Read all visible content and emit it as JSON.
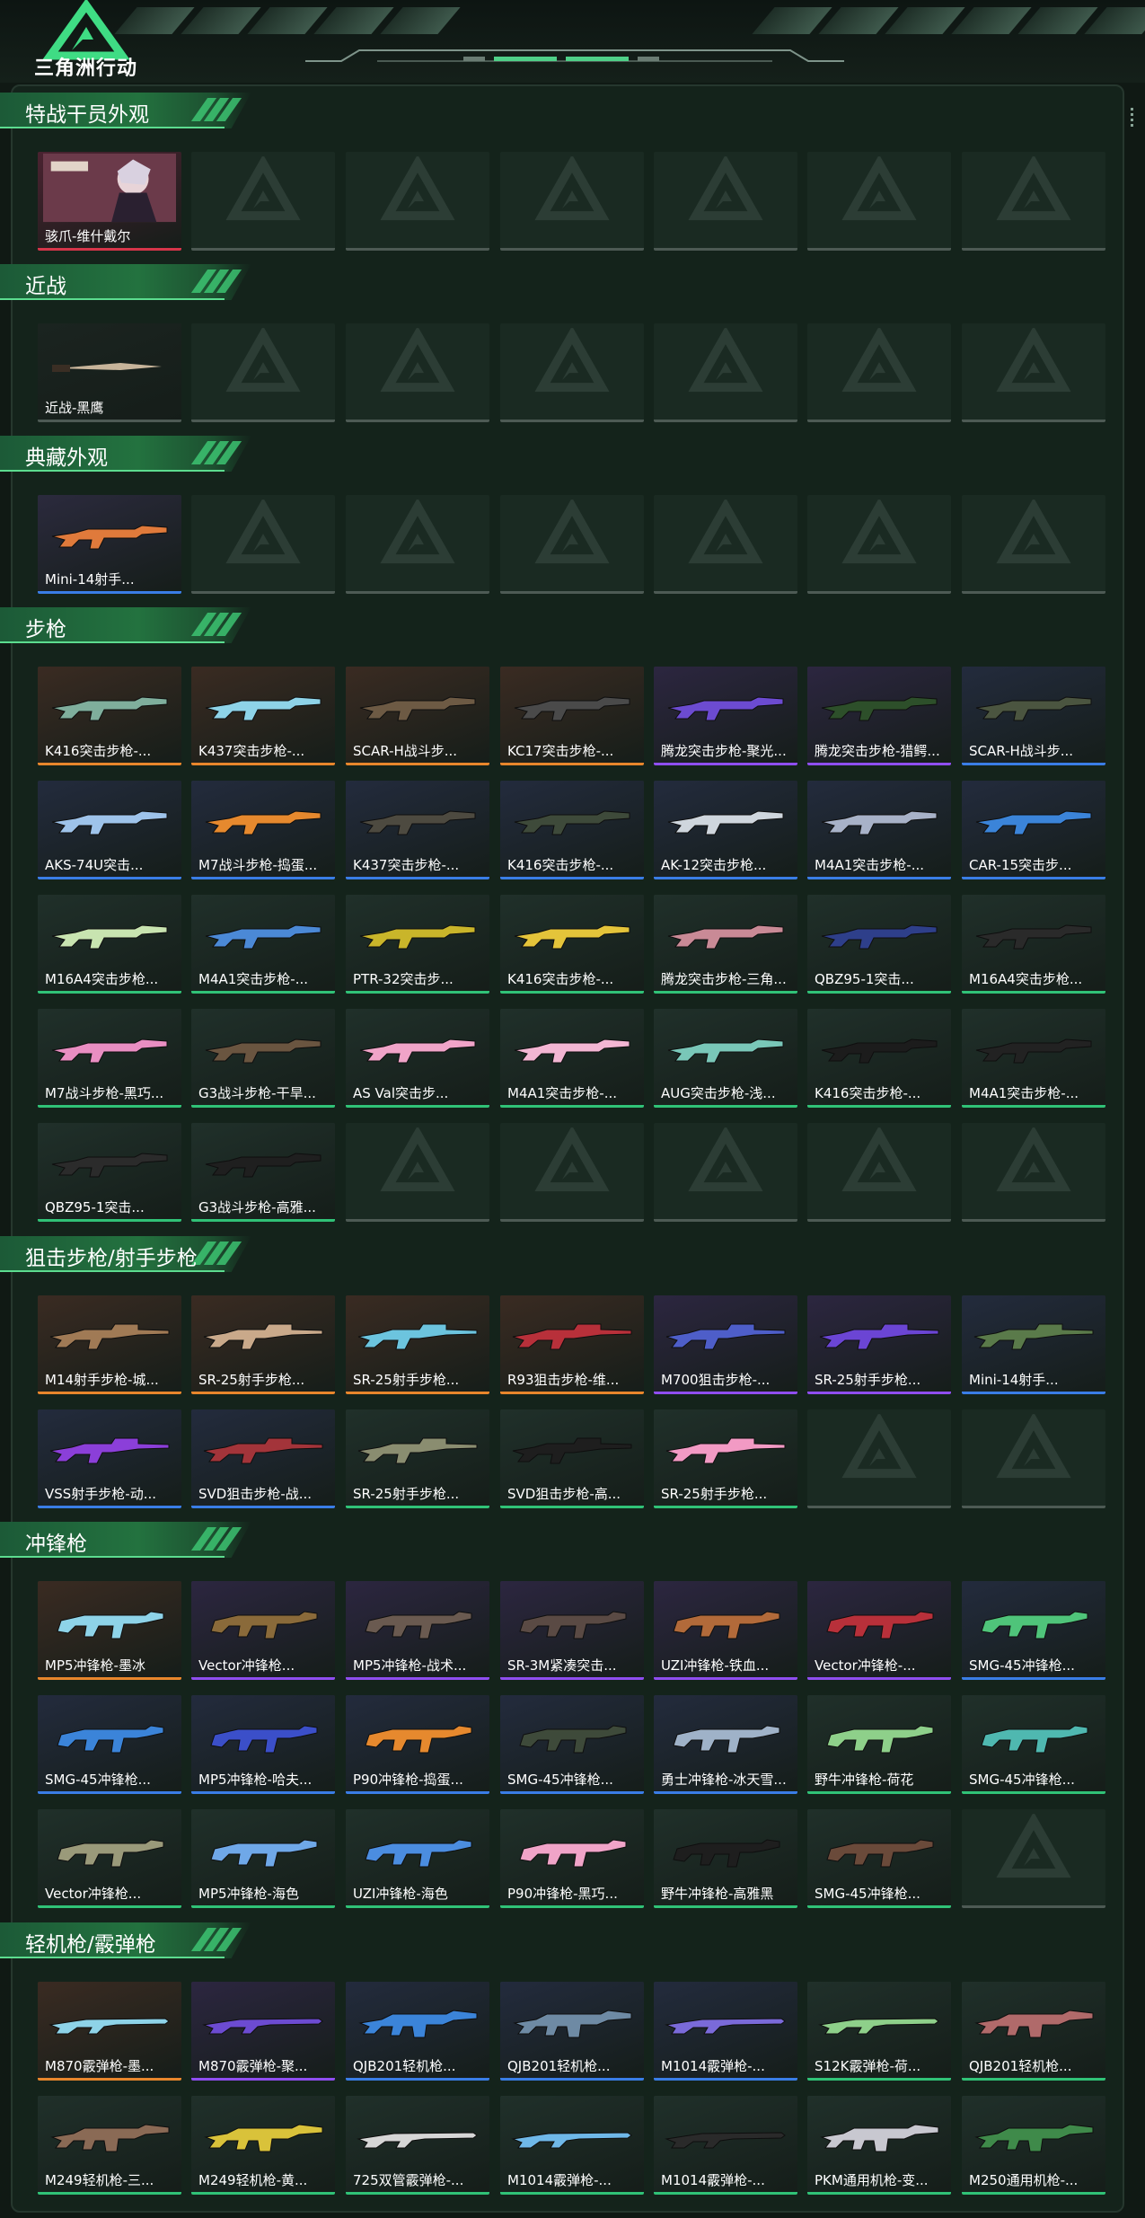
{
  "app": {
    "title": "三角洲行动"
  },
  "colors": {
    "accent": "#3fcb76",
    "rarity_red": "#d6354a",
    "rarity_orange": "#e8862c",
    "rarity_purple": "#8f4ef0",
    "rarity_blue": "#3a7de6",
    "rarity_green": "#30c277",
    "rarity_gray": "#4d5a54"
  },
  "sections": [
    {
      "title": "特战干员外观",
      "items": [
        {
          "name": "骇爪-维什戴尔",
          "rarity": "red",
          "bg": "#4a2230",
          "gun": "#c9c4cf",
          "icon": "operator-portrait"
        }
      ],
      "slots": 7
    },
    {
      "title": "近战",
      "items": [
        {
          "name": "近战-黑鹰",
          "rarity": "gray",
          "bg": "#1b2420",
          "gun": "#c7b49a",
          "icon": "knife-icon"
        }
      ],
      "slots": 7
    },
    {
      "title": "典藏外观",
      "items": [
        {
          "name": "Mini-14射手...",
          "rarity": "blue",
          "bg": "#2b2a3d",
          "gun": "#e07a3b",
          "icon": "rifle-icon"
        }
      ],
      "slots": 7
    },
    {
      "title": "步枪",
      "items": [
        {
          "name": "K416突击步枪-...",
          "rarity": "orange",
          "bg": "#3a2b22",
          "gun": "#7fae9c",
          "icon": "rifle-icon"
        },
        {
          "name": "K437突击步枪-...",
          "rarity": "orange",
          "bg": "#3a2b22",
          "gun": "#8ed3e8",
          "icon": "rifle-icon"
        },
        {
          "name": "SCAR-H战斗步...",
          "rarity": "orange",
          "bg": "#3a2b22",
          "gun": "#6d5a44",
          "icon": "rifle-icon"
        },
        {
          "name": "KC17突击步枪-...",
          "rarity": "orange",
          "bg": "#3a2b22",
          "gun": "#4a4a4a",
          "icon": "rifle-icon"
        },
        {
          "name": "腾龙突击步枪-聚光...",
          "rarity": "purple",
          "bg": "#2c2640",
          "gun": "#6c4bd1",
          "icon": "rifle-icon"
        },
        {
          "name": "腾龙突击步枪-猎鳄...",
          "rarity": "purple",
          "bg": "#2c2640",
          "gun": "#2d4f2a",
          "icon": "rifle-icon"
        },
        {
          "name": "SCAR-H战斗步...",
          "rarity": "blue",
          "bg": "#232b3d",
          "gun": "#4b5540",
          "icon": "rifle-icon"
        },
        {
          "name": "AKS-74U突击...",
          "rarity": "blue",
          "bg": "#232b3d",
          "gun": "#9ec3ea",
          "icon": "rifle-icon"
        },
        {
          "name": "M7战斗步枪-捣蛋...",
          "rarity": "blue",
          "bg": "#232b3d",
          "gun": "#e6892e",
          "icon": "rifle-icon"
        },
        {
          "name": "K437突击步枪-...",
          "rarity": "blue",
          "bg": "#232b3d",
          "gun": "#4d4a40",
          "icon": "rifle-icon"
        },
        {
          "name": "K416突击步枪-...",
          "rarity": "blue",
          "bg": "#232b3d",
          "gun": "#3e4a3a",
          "icon": "rifle-icon"
        },
        {
          "name": "AK-12突击步枪...",
          "rarity": "blue",
          "bg": "#232b3d",
          "gun": "#cfd6dd",
          "icon": "rifle-icon"
        },
        {
          "name": "M4A1突击步枪-...",
          "rarity": "blue",
          "bg": "#232b3d",
          "gun": "#a8b2c8",
          "icon": "rifle-icon"
        },
        {
          "name": "CAR-15突击步...",
          "rarity": "blue",
          "bg": "#232b3d",
          "gun": "#3b84d9",
          "icon": "rifle-icon"
        },
        {
          "name": "M16A4突击步枪...",
          "rarity": "green",
          "bg": "#20302a",
          "gun": "#c8e4b0",
          "icon": "rifle-icon"
        },
        {
          "name": "M4A1突击步枪-...",
          "rarity": "green",
          "bg": "#20302a",
          "gun": "#4b89d6",
          "icon": "rifle-icon"
        },
        {
          "name": "PTR-32突击步...",
          "rarity": "green",
          "bg": "#20302a",
          "gun": "#c9b52a",
          "icon": "rifle-icon"
        },
        {
          "name": "K416突击步枪-...",
          "rarity": "green",
          "bg": "#20302a",
          "gun": "#e4c43a",
          "icon": "rifle-icon"
        },
        {
          "name": "腾龙突击步枪-三角...",
          "rarity": "green",
          "bg": "#20302a",
          "gun": "#c98a96",
          "icon": "rifle-icon"
        },
        {
          "name": "QBZ95-1突击...",
          "rarity": "green",
          "bg": "#20302a",
          "gun": "#2e3f8a",
          "icon": "rifle-icon"
        },
        {
          "name": "M16A4突击步枪...",
          "rarity": "green",
          "bg": "#20302a",
          "gun": "#2a2a2a",
          "icon": "rifle-icon"
        },
        {
          "name": "M7战斗步枪-黑巧...",
          "rarity": "green",
          "bg": "#20302a",
          "gun": "#e98ec2",
          "icon": "rifle-icon"
        },
        {
          "name": "G3战斗步枪-干旱...",
          "rarity": "green",
          "bg": "#20302a",
          "gun": "#6a5540",
          "icon": "rifle-icon"
        },
        {
          "name": "AS Val突击步...",
          "rarity": "green",
          "bg": "#20302a",
          "gun": "#f0a4c8",
          "icon": "rifle-icon"
        },
        {
          "name": "M4A1突击步枪-...",
          "rarity": "green",
          "bg": "#20302a",
          "gun": "#f3b6d3",
          "icon": "rifle-icon"
        },
        {
          "name": "AUG突击步枪-浅...",
          "rarity": "green",
          "bg": "#20302a",
          "gun": "#79c7b8",
          "icon": "rifle-icon"
        },
        {
          "name": "K416突击步枪-...",
          "rarity": "green",
          "bg": "#20302a",
          "gun": "#1c1c1c",
          "icon": "rifle-icon"
        },
        {
          "name": "M4A1突击步枪-...",
          "rarity": "green",
          "bg": "#20302a",
          "gun": "#222222",
          "icon": "rifle-icon"
        },
        {
          "name": "QBZ95-1突击...",
          "rarity": "green",
          "bg": "#20302a",
          "gun": "#2b2b2b",
          "icon": "rifle-icon"
        },
        {
          "name": "G3战斗步枪-高雅...",
          "rarity": "green",
          "bg": "#20302a",
          "gun": "#1f1f1f",
          "icon": "rifle-icon"
        }
      ],
      "slots": 35
    },
    {
      "title": "狙击步枪/射手步枪",
      "items": [
        {
          "name": "M14射手步枪-城...",
          "rarity": "orange",
          "bg": "#3a2b22",
          "gun": "#a07a55",
          "icon": "sniper-icon"
        },
        {
          "name": "SR-25射手步枪...",
          "rarity": "orange",
          "bg": "#3a2b22",
          "gun": "#c9a98a",
          "icon": "sniper-icon"
        },
        {
          "name": "SR-25射手步枪...",
          "rarity": "orange",
          "bg": "#3a2b22",
          "gun": "#6cc4de",
          "icon": "sniper-icon"
        },
        {
          "name": "R93狙击步枪-维...",
          "rarity": "orange",
          "bg": "#3a2b22",
          "gun": "#b8303a",
          "icon": "sniper-icon"
        },
        {
          "name": "M700狙击步枪-...",
          "rarity": "purple",
          "bg": "#2c2640",
          "gun": "#4e5ec9",
          "icon": "sniper-icon"
        },
        {
          "name": "SR-25射手步枪...",
          "rarity": "purple",
          "bg": "#2c2640",
          "gun": "#6b45d4",
          "icon": "sniper-icon"
        },
        {
          "name": "Mini-14射手...",
          "rarity": "blue",
          "bg": "#232b3d",
          "gun": "#5a7a4a",
          "icon": "sniper-icon"
        },
        {
          "name": "VSS射手步枪-动...",
          "rarity": "blue",
          "bg": "#232b3d",
          "gun": "#8b3fd9",
          "icon": "sniper-icon"
        },
        {
          "name": "SVD狙击步枪-战...",
          "rarity": "blue",
          "bg": "#232b3d",
          "gun": "#a3343a",
          "icon": "sniper-icon"
        },
        {
          "name": "SR-25射手步枪...",
          "rarity": "green",
          "bg": "#20302a",
          "gun": "#8a8d70",
          "icon": "sniper-icon"
        },
        {
          "name": "SVD狙击步枪-高...",
          "rarity": "green",
          "bg": "#20302a",
          "gun": "#1e1e1e",
          "icon": "sniper-icon"
        },
        {
          "name": "SR-25射手步枪...",
          "rarity": "green",
          "bg": "#20302a",
          "gun": "#f29ac4",
          "icon": "sniper-icon"
        }
      ],
      "slots": 14
    },
    {
      "title": "冲锋枪",
      "items": [
        {
          "name": "MP5冲锋枪-墨冰",
          "rarity": "orange",
          "bg": "#3a2b22",
          "gun": "#8ed3e8",
          "icon": "smg-icon"
        },
        {
          "name": "Vector冲锋枪...",
          "rarity": "purple",
          "bg": "#2c2640",
          "gun": "#8a6a3a",
          "icon": "smg-icon"
        },
        {
          "name": "MP5冲锋枪-战术...",
          "rarity": "purple",
          "bg": "#2c2640",
          "gun": "#6a5a50",
          "icon": "smg-icon"
        },
        {
          "name": "SR-3M紧凑突击...",
          "rarity": "purple",
          "bg": "#2c2640",
          "gun": "#5a4a44",
          "icon": "smg-icon"
        },
        {
          "name": "UZI冲锋枪-铁血...",
          "rarity": "purple",
          "bg": "#2c2640",
          "gun": "#b26a3a",
          "icon": "smg-icon"
        },
        {
          "name": "Vector冲锋枪-...",
          "rarity": "purple",
          "bg": "#2c2640",
          "gun": "#b8303a",
          "icon": "smg-icon"
        },
        {
          "name": "SMG-45冲锋枪...",
          "rarity": "blue",
          "bg": "#232b3d",
          "gun": "#4fc47a",
          "icon": "smg-icon"
        },
        {
          "name": "SMG-45冲锋枪...",
          "rarity": "blue",
          "bg": "#232b3d",
          "gun": "#3b84d9",
          "icon": "smg-icon"
        },
        {
          "name": "MP5冲锋枪-哈夫...",
          "rarity": "blue",
          "bg": "#232b3d",
          "gun": "#3b4fc9",
          "icon": "smg-icon"
        },
        {
          "name": "P90冲锋枪-捣蛋...",
          "rarity": "blue",
          "bg": "#232b3d",
          "gun": "#e6892e",
          "icon": "smg-icon"
        },
        {
          "name": "SMG-45冲锋枪...",
          "rarity": "blue",
          "bg": "#232b3d",
          "gun": "#3e4a3a",
          "icon": "smg-icon"
        },
        {
          "name": "勇士冲锋枪-冰天雪...",
          "rarity": "blue",
          "bg": "#232b3d",
          "gun": "#9fb2c8",
          "icon": "smg-icon"
        },
        {
          "name": "野牛冲锋枪-荷花",
          "rarity": "green",
          "bg": "#20302a",
          "gun": "#8ed08a",
          "icon": "smg-icon"
        },
        {
          "name": "SMG-45冲锋枪...",
          "rarity": "green",
          "bg": "#20302a",
          "gun": "#4fb8b0",
          "icon": "smg-icon"
        },
        {
          "name": "Vector冲锋枪...",
          "rarity": "green",
          "bg": "#20302a",
          "gun": "#9a9a7a",
          "icon": "smg-icon"
        },
        {
          "name": "MP5冲锋枪-海色",
          "rarity": "green",
          "bg": "#20302a",
          "gun": "#6fa8e8",
          "icon": "smg-icon"
        },
        {
          "name": "UZI冲锋枪-海色",
          "rarity": "green",
          "bg": "#20302a",
          "gun": "#4b8de0",
          "icon": "smg-icon"
        },
        {
          "name": "P90冲锋枪-黑巧...",
          "rarity": "green",
          "bg": "#20302a",
          "gun": "#f0a4c8",
          "icon": "smg-icon"
        },
        {
          "name": "野牛冲锋枪-高雅黑",
          "rarity": "green",
          "bg": "#20302a",
          "gun": "#1e1e1e",
          "icon": "smg-icon"
        },
        {
          "name": "SMG-45冲锋枪...",
          "rarity": "green",
          "bg": "#20302a",
          "gun": "#6a4a3a",
          "icon": "smg-icon"
        }
      ],
      "slots": 21
    },
    {
      "title": "轻机枪/霰弹枪",
      "items": [
        {
          "name": "M870霰弹枪-墨...",
          "rarity": "orange",
          "bg": "#3a2b22",
          "gun": "#8ed3e8",
          "icon": "shotgun-icon"
        },
        {
          "name": "M870霰弹枪-聚...",
          "rarity": "purple",
          "bg": "#2c2640",
          "gun": "#6c4bd1",
          "icon": "shotgun-icon"
        },
        {
          "name": "QJB201轻机枪...",
          "rarity": "blue",
          "bg": "#232b3d",
          "gun": "#3b84d9",
          "icon": "lmg-icon"
        },
        {
          "name": "QJB201轻机枪...",
          "rarity": "blue",
          "bg": "#232b3d",
          "gun": "#6e8aa4",
          "icon": "lmg-icon"
        },
        {
          "name": "M1014霰弹枪-...",
          "rarity": "blue",
          "bg": "#232b3d",
          "gun": "#7a6ad9",
          "icon": "shotgun-icon"
        },
        {
          "name": "S12K霰弹枪-荷...",
          "rarity": "green",
          "bg": "#20302a",
          "gun": "#8ed08a",
          "icon": "shotgun-icon"
        },
        {
          "name": "QJB201轻机枪...",
          "rarity": "green",
          "bg": "#20302a",
          "gun": "#b06a6a",
          "icon": "lmg-icon"
        },
        {
          "name": "M249轻机枪-三...",
          "rarity": "green",
          "bg": "#20302a",
          "gun": "#8a6a55",
          "icon": "lmg-icon"
        },
        {
          "name": "M249轻机枪-黄...",
          "rarity": "green",
          "bg": "#20302a",
          "gun": "#d9c23a",
          "icon": "lmg-icon"
        },
        {
          "name": "725双管霰弹枪-...",
          "rarity": "green",
          "bg": "#20302a",
          "gun": "#d6d6d6",
          "icon": "shotgun-icon"
        },
        {
          "name": "M1014霰弹枪-...",
          "rarity": "green",
          "bg": "#20302a",
          "gun": "#6fb8e8",
          "icon": "shotgun-icon"
        },
        {
          "name": "M1014霰弹枪-...",
          "rarity": "green",
          "bg": "#20302a",
          "gun": "#2a2a2a",
          "icon": "shotgun-icon"
        },
        {
          "name": "PKM通用机枪-变...",
          "rarity": "green",
          "bg": "#20302a",
          "gun": "#c8c8d0",
          "icon": "lmg-icon"
        },
        {
          "name": "M250通用机枪-...",
          "rarity": "green",
          "bg": "#20302a",
          "gun": "#3f8a4a",
          "icon": "lmg-icon"
        }
      ],
      "slots": 14
    }
  ]
}
